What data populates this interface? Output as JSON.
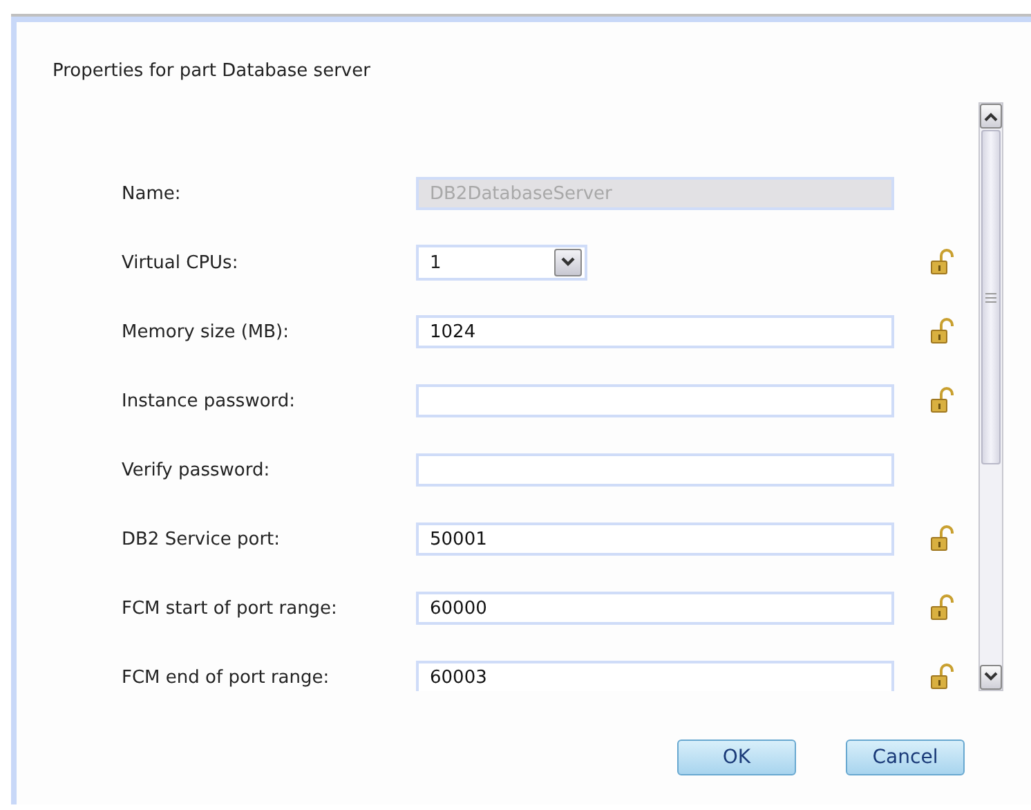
{
  "dialog": {
    "title": "Properties for part Database server"
  },
  "fields": [
    {
      "kind": "text",
      "label": "Name:",
      "value": "DB2DatabaseServer",
      "disabled": true,
      "lock_icon": false
    },
    {
      "kind": "select",
      "label": "Virtual CPUs:",
      "value": "1",
      "lock_icon": true
    },
    {
      "kind": "text",
      "label": "Memory size (MB):",
      "value": "1024",
      "disabled": false,
      "lock_icon": true
    },
    {
      "kind": "text",
      "label": "Instance password:",
      "disabled": false,
      "lock_icon": true
    },
    {
      "kind": "text",
      "label": "Verify password:",
      "disabled": false,
      "lock_icon": false
    },
    {
      "kind": "text",
      "label": "DB2 Service port:",
      "value": "50001",
      "disabled": false,
      "lock_icon": true
    },
    {
      "kind": "text",
      "label": "FCM start of port range:",
      "value": "60000",
      "disabled": false,
      "lock_icon": true
    },
    {
      "kind": "text",
      "label": "FCM end of port range:",
      "value": "60003",
      "disabled": false,
      "lock_icon": true
    }
  ],
  "buttons": [
    {
      "label": "OK"
    },
    {
      "label": "Cancel"
    }
  ]
}
